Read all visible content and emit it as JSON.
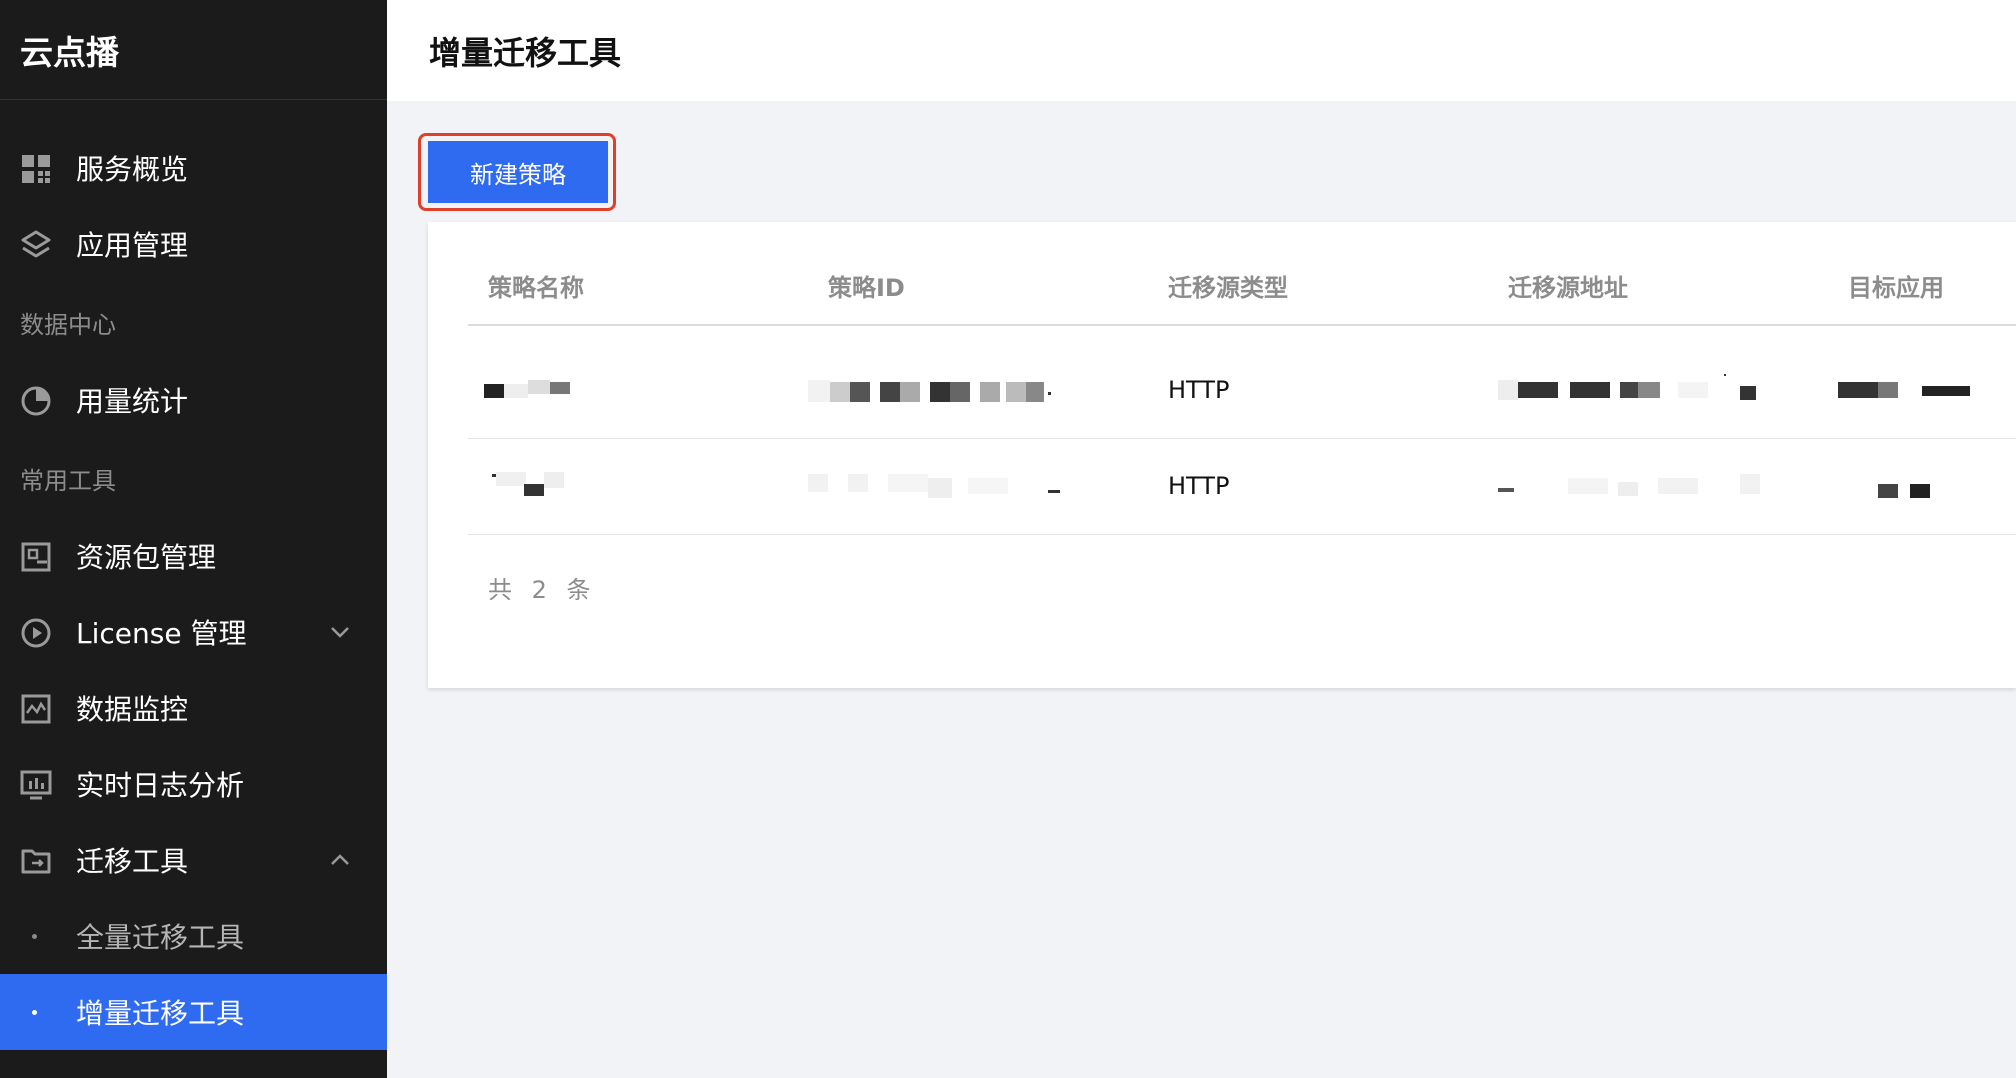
{
  "sidebar": {
    "brand": "云点播",
    "items_top": [
      {
        "label": "服务概览",
        "icon": "dashboard-grid-icon"
      },
      {
        "label": "应用管理",
        "icon": "layers-icon"
      }
    ],
    "group_data_center": "数据中心",
    "usage_stats": {
      "label": "用量统计",
      "icon": "pie-chart-icon"
    },
    "group_common_tools": "常用工具",
    "items_tools": [
      {
        "label": "资源包管理",
        "icon": "package-icon"
      },
      {
        "label": "License 管理",
        "icon": "play-circle-icon",
        "expanded": false
      },
      {
        "label": "数据监控",
        "icon": "monitor-chart-icon"
      },
      {
        "label": "实时日志分析",
        "icon": "screen-analytics-icon"
      },
      {
        "label": "迁移工具",
        "icon": "folder-transfer-icon",
        "expanded": true
      }
    ],
    "sub_items": [
      {
        "label": "全量迁移工具",
        "active": false
      },
      {
        "label": "增量迁移工具",
        "active": true
      }
    ]
  },
  "header": {
    "title": "增量迁移工具"
  },
  "toolbar": {
    "new_strategy_label": "新建策略"
  },
  "table": {
    "columns": [
      "策略名称",
      "策略ID",
      "迁移源类型",
      "迁移源地址",
      "目标应用"
    ],
    "rows": [
      {
        "source_type": "HTTP"
      },
      {
        "source_type": "HTTP"
      }
    ],
    "total_text": "共 2 条"
  },
  "colors": {
    "sidebar_bg": "#1b1b1b",
    "accent": "#2f6bf0",
    "highlight_outline": "#e0402b",
    "page_bg": "#f2f3f7"
  }
}
